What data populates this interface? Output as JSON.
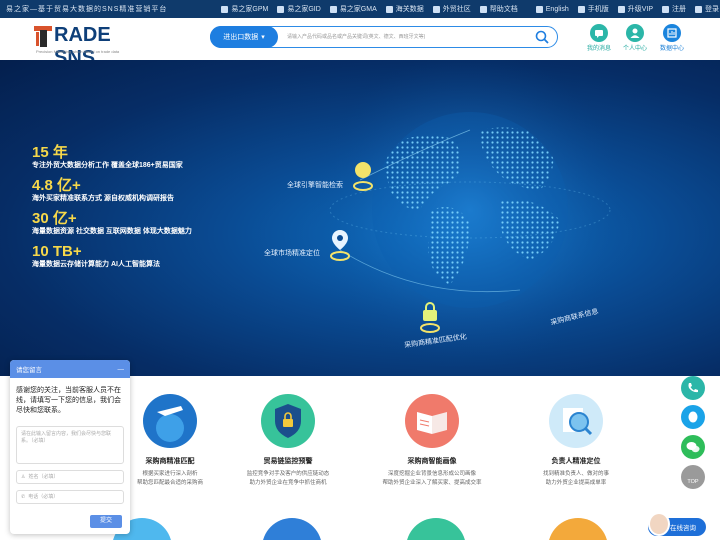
{
  "topbar": {
    "slogan": "易之家—基于贸易大数据的SNS精准营销平台",
    "links": [
      {
        "label": "易之家GPM"
      },
      {
        "label": "易之家GID"
      },
      {
        "label": "易之家GMA"
      },
      {
        "label": "海关数据"
      },
      {
        "label": "外贸社区"
      },
      {
        "label": "帮助文档"
      }
    ],
    "right": [
      {
        "label": "English"
      },
      {
        "label": "手机版"
      },
      {
        "label": "升级VIP"
      },
      {
        "label": "注册"
      },
      {
        "label": "登录"
      }
    ]
  },
  "header": {
    "brand": "RADE SNS",
    "brand_t": "T",
    "tagline": "Precision Marketing which based on trade data",
    "search_select": "进出口数据",
    "search_placeholder": "请输入产品代码或品名或产品关键词(英文、德文、西班牙文等)",
    "icons": [
      {
        "label": "我的消息",
        "color": "#2bb6a8"
      },
      {
        "label": "个人中心",
        "color": "#2bb6a8"
      },
      {
        "label": "数据中心",
        "color": "#1a84dd"
      }
    ]
  },
  "hero": {
    "stats": [
      {
        "num": "15 年",
        "desc": "专注外贸大数据分析工作 覆盖全球186+贸易国家"
      },
      {
        "num": "4.8 亿+",
        "desc": "海外买家精准联系方式 源自权威机构调研报告"
      },
      {
        "num": "30 亿+",
        "desc": "海量数据资源 社交数据 互联网数据 体现大数据魅力"
      },
      {
        "num": "10 TB+",
        "desc": "海量数据云存储计算能力  AI人工智能算法"
      }
    ],
    "labels": {
      "l1": "全球引擎智能检索",
      "l2": "全球市场精准定位",
      "l3": "采购商精准匹配优化",
      "l4": "采购商联系信息"
    }
  },
  "features": [
    {
      "title": "采购商精准匹配",
      "desc1": "根据买家进行深入剖析",
      "desc2": "帮助您匹配最合适的采购商",
      "color": "#1f74c9"
    },
    {
      "title": "贸易链监控预警",
      "desc1": "监控竞争对手及客户的供应链动态",
      "desc2": "助力外贸企业在竞争中抓住商机",
      "color": "#37c39a"
    },
    {
      "title": "采购商智能画像",
      "desc1": "深度挖掘企业背景信息形成公司画像",
      "desc2": "帮助外贸企业深入了解买家、提高成交率",
      "color": "#f07a6b"
    },
    {
      "title": "负责人精准定位",
      "desc1": "找到精准负责人、做对的事",
      "desc2": "助力外贸企业提高成单率",
      "color": "#7cc3ef"
    }
  ],
  "chat": {
    "title": "请您留言",
    "close": "—",
    "message": "感谢您的关注，当前客服人员不在线，请填写一下您的信息，我们会尽快和您联系。",
    "textarea_placeholder": "请在此输入留言内容，我们会尽快与您联系。（必填）",
    "name_placeholder": "姓名（必填）",
    "phone_placeholder": "电话（必填）",
    "submit": "提交"
  },
  "float_bar": {
    "top_label": "TOP",
    "colors": [
      "#2bb6a8",
      "#1aa3e8",
      "#2ebd5a"
    ]
  },
  "online": {
    "label": "在线咨询"
  }
}
